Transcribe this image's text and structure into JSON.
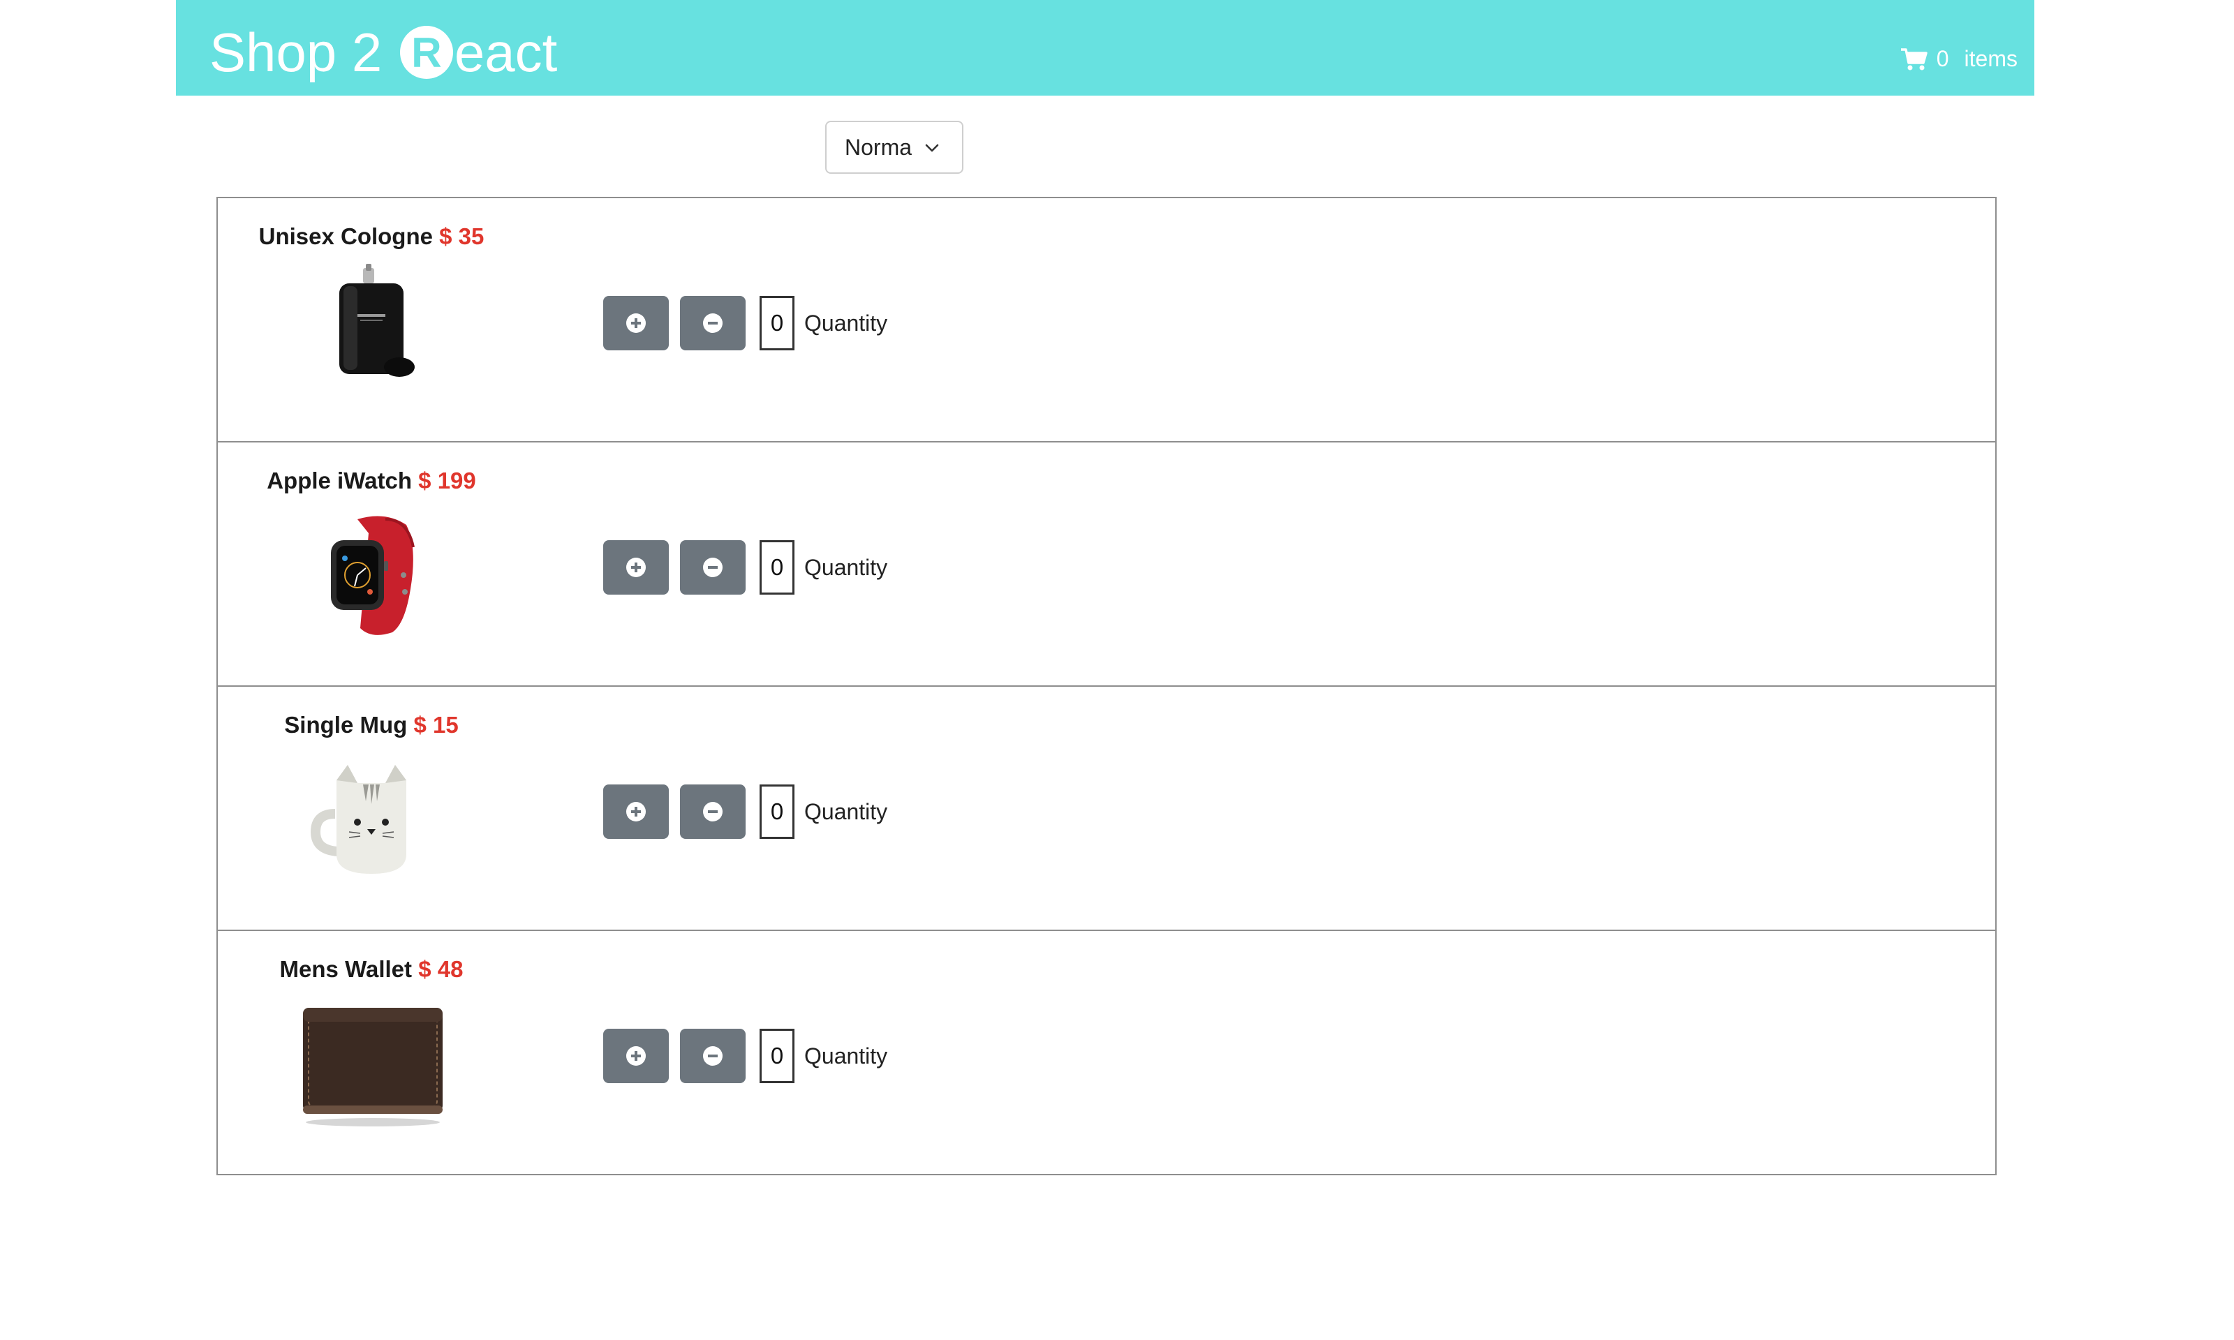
{
  "header": {
    "logo_prefix": "Shop 2 ",
    "logo_r": "R",
    "logo_suffix": "eact",
    "cart_count": "0",
    "cart_label": "items",
    "cart_icon": "shopping-cart-icon"
  },
  "sort": {
    "selected": "Norma",
    "icon": "chevron-down-icon"
  },
  "products": [
    {
      "name": "Unisex Cologne",
      "price": "$ 35",
      "quantity": "0",
      "quantity_label": "Quantity",
      "image": "cologne-bottle"
    },
    {
      "name": "Apple iWatch",
      "price": "$ 199",
      "quantity": "0",
      "quantity_label": "Quantity",
      "image": "smartwatch"
    },
    {
      "name": "Single Mug",
      "price": "$ 15",
      "quantity": "0",
      "quantity_label": "Quantity",
      "image": "cat-mug"
    },
    {
      "name": "Mens Wallet",
      "price": "$ 48",
      "quantity": "0",
      "quantity_label": "Quantity",
      "image": "leather-wallet"
    }
  ],
  "colors": {
    "header_bg": "#67e1e0",
    "price": "#e0362c",
    "button_bg": "#6c757d"
  }
}
